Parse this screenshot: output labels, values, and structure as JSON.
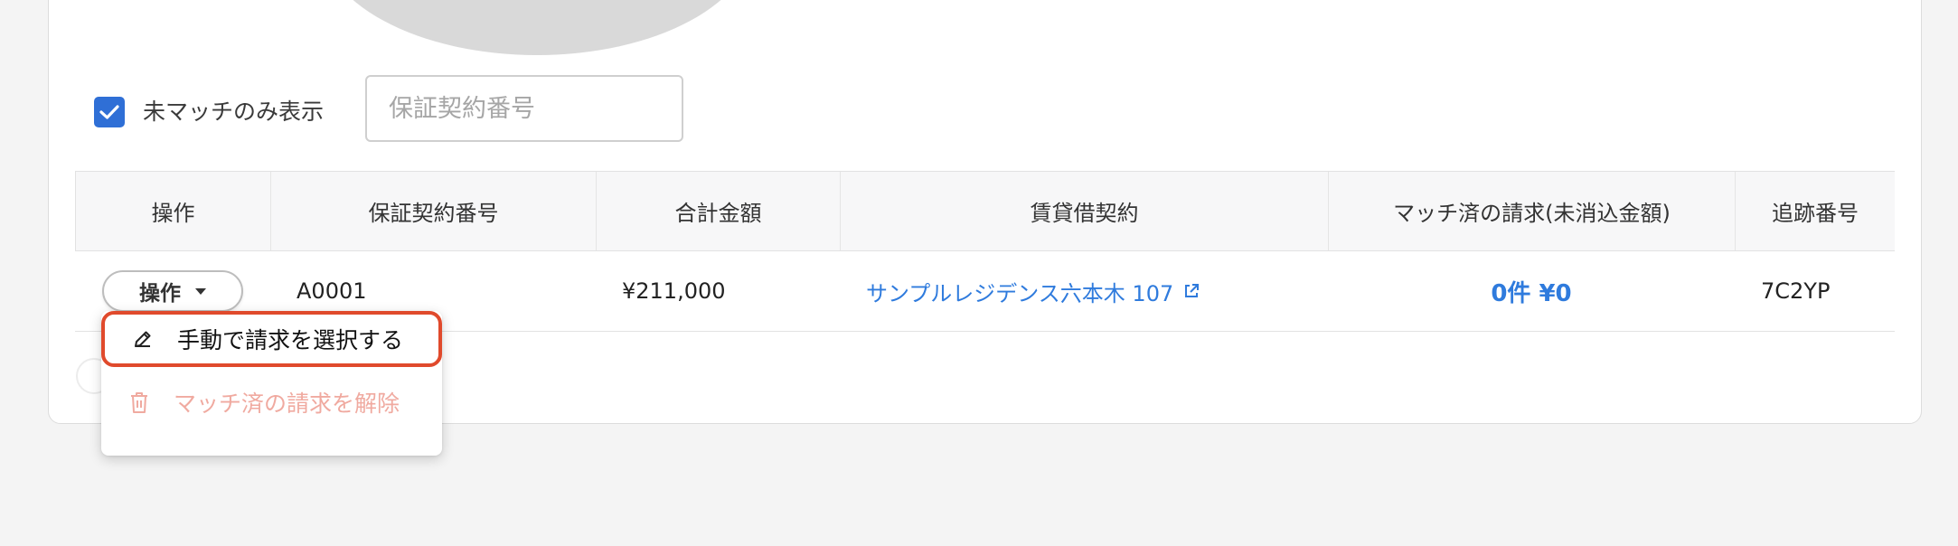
{
  "filter": {
    "unmatched_only_label": "未マッチのみ表示",
    "unmatched_only_checked": true,
    "search_placeholder": "保証契約番号",
    "search_value": ""
  },
  "table": {
    "columns": [
      "操作",
      "保証契約番号",
      "合計金額",
      "賃貸借契約",
      "マッチ済の請求(未消込金額)",
      "追跡番号"
    ],
    "rows": [
      {
        "action_label": "操作",
        "contract_number": "A0001",
        "total_amount": "¥211,000",
        "rental_contract": "サンプルレジデンス六本木 107",
        "matched_invoice": "0件 ¥0",
        "tracking_number": "7C2YP"
      }
    ]
  },
  "action_menu": {
    "items": [
      {
        "label": "手動で請求を選択する",
        "icon": "pencil-icon",
        "state": "highlighted"
      },
      {
        "label": "マッチ済の請求を解除",
        "icon": "trash-icon",
        "state": "disabled"
      }
    ]
  },
  "colors": {
    "accent_blue": "#2f7bdd",
    "checkbox_blue": "#2f6fd6",
    "highlight_red": "#e04a2c",
    "disabled_text": "#f0aaa0"
  }
}
